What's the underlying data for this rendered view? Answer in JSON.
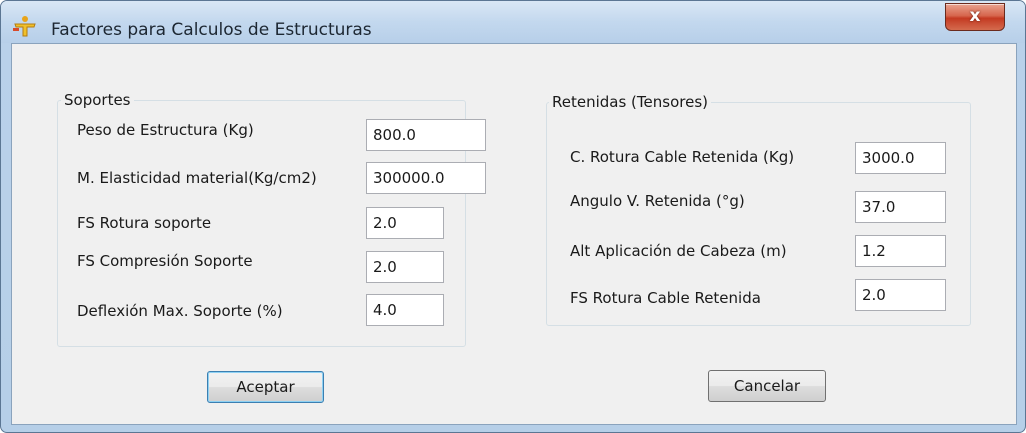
{
  "window": {
    "title": "Factores para Calculos de Estructuras",
    "close_label": "x"
  },
  "soportes": {
    "title": "Soportes",
    "fields": [
      {
        "label": "Peso de Estructura (Kg)",
        "value": "800.0"
      },
      {
        "label": "M. Elasticidad material(Kg/cm2)",
        "value": "300000.0"
      },
      {
        "label": "FS Rotura soporte",
        "value": "2.0"
      },
      {
        "label": "FS Compresión Soporte",
        "value": "2.0"
      },
      {
        "label": "Deflexión Max. Soporte (%)",
        "value": "4.0"
      }
    ]
  },
  "retenidas": {
    "title": "Retenidas (Tensores)",
    "fields": [
      {
        "label": "C. Rotura Cable Retenida (Kg)",
        "value": "3000.0"
      },
      {
        "label": "Angulo V. Retenida (°g)",
        "value": "37.0"
      },
      {
        "label": "Alt Aplicación de Cabeza (m)",
        "value": "1.2"
      },
      {
        "label": "FS Rotura Cable Retenida",
        "value": "2.0"
      }
    ]
  },
  "buttons": {
    "accept": "Aceptar",
    "cancel": "Cancelar"
  },
  "icons": {
    "app": "yellow-figure-icon",
    "close": "close-icon"
  }
}
